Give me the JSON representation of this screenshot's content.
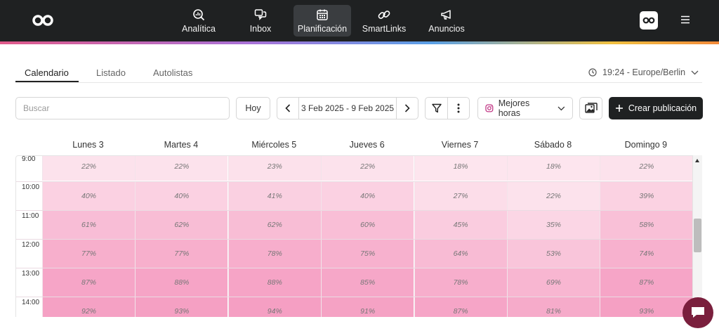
{
  "nav": {
    "items": [
      {
        "label": "Analítica",
        "icon": "analytics-icon"
      },
      {
        "label": "Inbox",
        "icon": "inbox-icon"
      },
      {
        "label": "Planificación",
        "icon": "calendar-icon",
        "active": true
      },
      {
        "label": "SmartLinks",
        "icon": "link-icon"
      },
      {
        "label": "Anuncios",
        "icon": "megaphone-icon"
      }
    ]
  },
  "tabs": [
    {
      "label": "Calendario",
      "active": true
    },
    {
      "label": "Listado"
    },
    {
      "label": "Autolistas"
    }
  ],
  "timezone": "19:24 - Europe/Berlin",
  "toolbar": {
    "search_placeholder": "Buscar",
    "today_label": "Hoy",
    "date_range": "3 Feb 2025 - 9 Feb 2025",
    "best_hours_label": "Mejores horas",
    "create_label": "Crear publicación"
  },
  "calendar": {
    "days": [
      "Lunes 3",
      "Martes 4",
      "Miércoles 5",
      "Jueves 6",
      "Viernes 7",
      "Sábado 8",
      "Domingo 9"
    ],
    "rows": [
      {
        "time": "9:00",
        "values": [
          "22%",
          "22%",
          "23%",
          "22%",
          "18%",
          "18%",
          "22%"
        ]
      },
      {
        "time": "10:00",
        "values": [
          "40%",
          "40%",
          "41%",
          "40%",
          "27%",
          "22%",
          "39%"
        ]
      },
      {
        "time": "11:00",
        "values": [
          "61%",
          "62%",
          "62%",
          "60%",
          "45%",
          "35%",
          "58%"
        ]
      },
      {
        "time": "12:00",
        "values": [
          "77%",
          "77%",
          "78%",
          "75%",
          "64%",
          "53%",
          "74%"
        ]
      },
      {
        "time": "13:00",
        "values": [
          "87%",
          "88%",
          "88%",
          "85%",
          "78%",
          "69%",
          "87%"
        ]
      },
      {
        "time": "14:00",
        "values": [
          "92%",
          "93%",
          "94%",
          "91%",
          "87%",
          "81%",
          "93%"
        ]
      }
    ]
  },
  "colors": {
    "nav_bg": "#1f2122",
    "heat_low": "#fde6ee",
    "heat_high": "#f59cc0",
    "chat_button": "#7a1f3d"
  }
}
